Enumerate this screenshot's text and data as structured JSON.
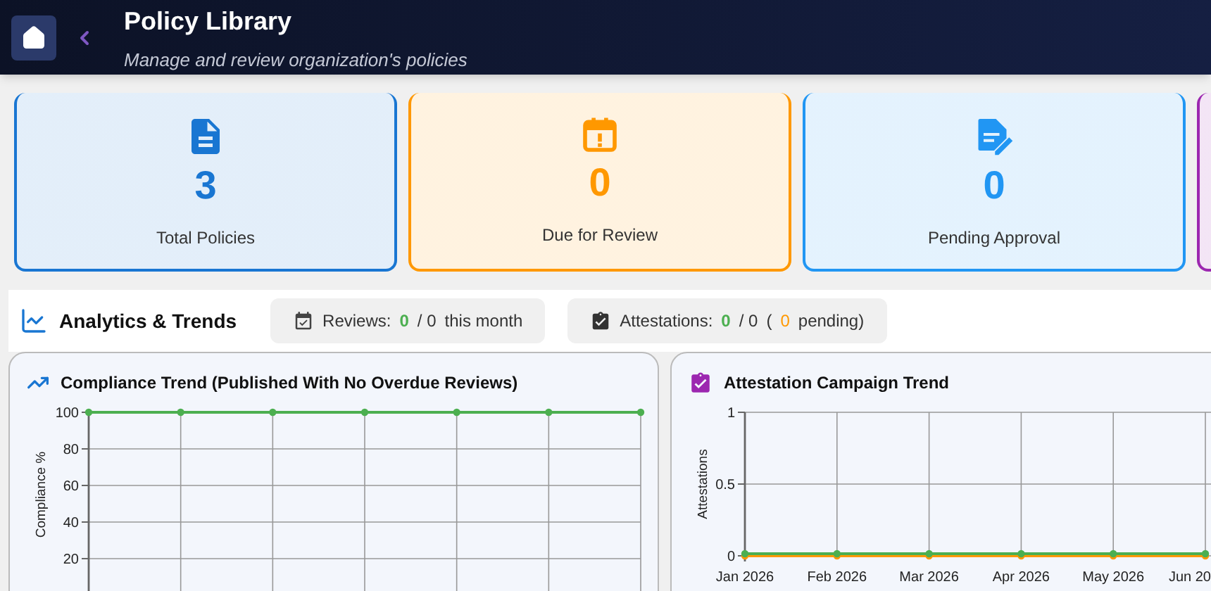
{
  "header": {
    "title": "Policy Library",
    "subtitle": "Manage and review organization's policies"
  },
  "stat_cards": [
    {
      "kind": "document",
      "value": "3",
      "label": "Total Policies",
      "color": "#1976d2"
    },
    {
      "kind": "calendar",
      "value": "0",
      "label": "Due for Review",
      "color": "#ff9800"
    },
    {
      "kind": "edit",
      "value": "0",
      "label": "Pending Approval",
      "color": "#2196f3"
    },
    {
      "kind": "blank",
      "color": "#9c27b0"
    }
  ],
  "analytics": {
    "title": "Analytics & Trends",
    "chips": [
      {
        "kind": "reviews",
        "parts": [
          {
            "kind": "plain",
            "text": "Reviews:"
          },
          {
            "kind": "good",
            "text": "0"
          },
          {
            "kind": "plain",
            "text": "/ 0"
          },
          {
            "kind": "plain",
            "text": "this month"
          }
        ]
      },
      {
        "kind": "attestations",
        "parts": [
          {
            "kind": "plain",
            "text": "Attestations:"
          },
          {
            "kind": "good",
            "text": "0"
          },
          {
            "kind": "plain",
            "text": "/ 0"
          },
          {
            "kind": "plain",
            "text": "("
          },
          {
            "kind": "warn",
            "text": "0"
          },
          {
            "kind": "plain",
            "text": "pending)"
          }
        ]
      }
    ]
  },
  "charts": [
    {
      "kind": "trend",
      "title": "Compliance Trend (Published With No Overdue Reviews)",
      "chart_data": {
        "type": "line",
        "ylabel": "Compliance %",
        "grid": true,
        "yticks": [
          20,
          40,
          60,
          80,
          100
        ],
        "ylim": [
          0,
          100
        ],
        "series": [
          {
            "color": "#4caf50",
            "marker": true,
            "values": [
              100,
              100,
              100,
              100,
              100,
              100,
              100
            ]
          }
        ]
      }
    },
    {
      "kind": "attestation",
      "title": "Attestation Campaign Trend",
      "chart_data": {
        "type": "line",
        "ylabel": "Attestations",
        "grid": true,
        "categories": [
          "Jan 2026",
          "Feb 2026",
          "Mar 2026",
          "Apr 2026",
          "May 2026",
          "Jun 20"
        ],
        "yticks": [
          0,
          0.5,
          1
        ],
        "ylim": [
          0,
          1
        ],
        "series": [
          {
            "color": "#ff9800",
            "marker": true,
            "values": [
              0,
              0,
              0,
              0,
              0,
              0
            ]
          },
          {
            "color": "#4caf50",
            "marker": true,
            "values": [
              0,
              0,
              0,
              0,
              0,
              0
            ]
          }
        ]
      }
    }
  ]
}
